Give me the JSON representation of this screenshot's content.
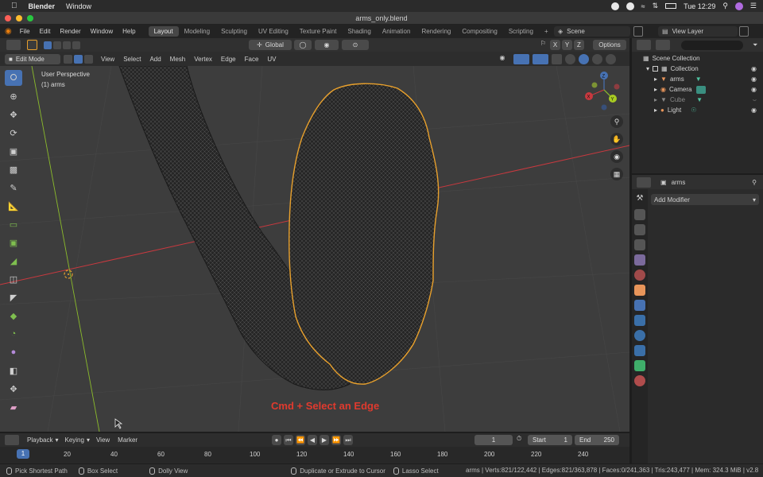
{
  "macos": {
    "app_name": "Blender",
    "menu": [
      "Window"
    ],
    "clock": "Tue 12:29"
  },
  "window": {
    "title": "arms_only.blend"
  },
  "topbar": {
    "menus": [
      "File",
      "Edit",
      "Render",
      "Window",
      "Help"
    ],
    "workspaces": [
      "Layout",
      "Modeling",
      "Sculpting",
      "UV Editing",
      "Texture Paint",
      "Shading",
      "Animation",
      "Rendering",
      "Compositing",
      "Scripting"
    ],
    "active_workspace": "Layout",
    "scene": "Scene",
    "view_layer": "View Layer"
  },
  "tool_header": {
    "orientation": "Global",
    "axes": [
      "X",
      "Y",
      "Z"
    ],
    "options_label": "Options"
  },
  "viewport_header": {
    "mode": "Edit Mode",
    "menus": [
      "View",
      "Select",
      "Add",
      "Mesh",
      "Vertex",
      "Edge",
      "Face",
      "UV"
    ]
  },
  "viewport": {
    "view_name": "User Perspective",
    "object_name": "(1) arms",
    "overlay_caption": "Cmd + Select an Edge",
    "gizmo_axes": [
      "X",
      "Y",
      "Z"
    ]
  },
  "outliner": {
    "root": "Scene Collection",
    "collection": "Collection",
    "items": [
      {
        "name": "arms",
        "color": "#e8955a"
      },
      {
        "name": "Camera",
        "color": "#e8955a"
      },
      {
        "name": "Cube",
        "color": "#888888"
      },
      {
        "name": "Light",
        "color": "#e8955a"
      }
    ]
  },
  "properties": {
    "object": "arms",
    "add_modifier": "Add Modifier"
  },
  "timeline": {
    "menus": [
      "Playback",
      "Keying",
      "View",
      "Marker"
    ],
    "current_frame": "1",
    "start_label": "Start",
    "start": "1",
    "end_label": "End",
    "end": "250",
    "ruler": [
      "1",
      "20",
      "40",
      "60",
      "80",
      "100",
      "120",
      "140",
      "160",
      "180",
      "200",
      "220",
      "240"
    ]
  },
  "statusbar": {
    "hints": [
      "Pick Shortest Path",
      "Box Select",
      "Dolly View",
      "Duplicate or Extrude to Cursor",
      "Lasso Select"
    ],
    "stats": "arms | Verts:821/122,442 | Edges:821/363,878 | Faces:0/241,363 | Tris:243,477 | Mem: 324.3 MiB | v2.8"
  },
  "colors": {
    "accent": "#4772b3",
    "selection": "#e8a02c",
    "x_axis": "#c8393f",
    "y_axis": "#8bbb2b",
    "caption": "#e03a2e"
  }
}
